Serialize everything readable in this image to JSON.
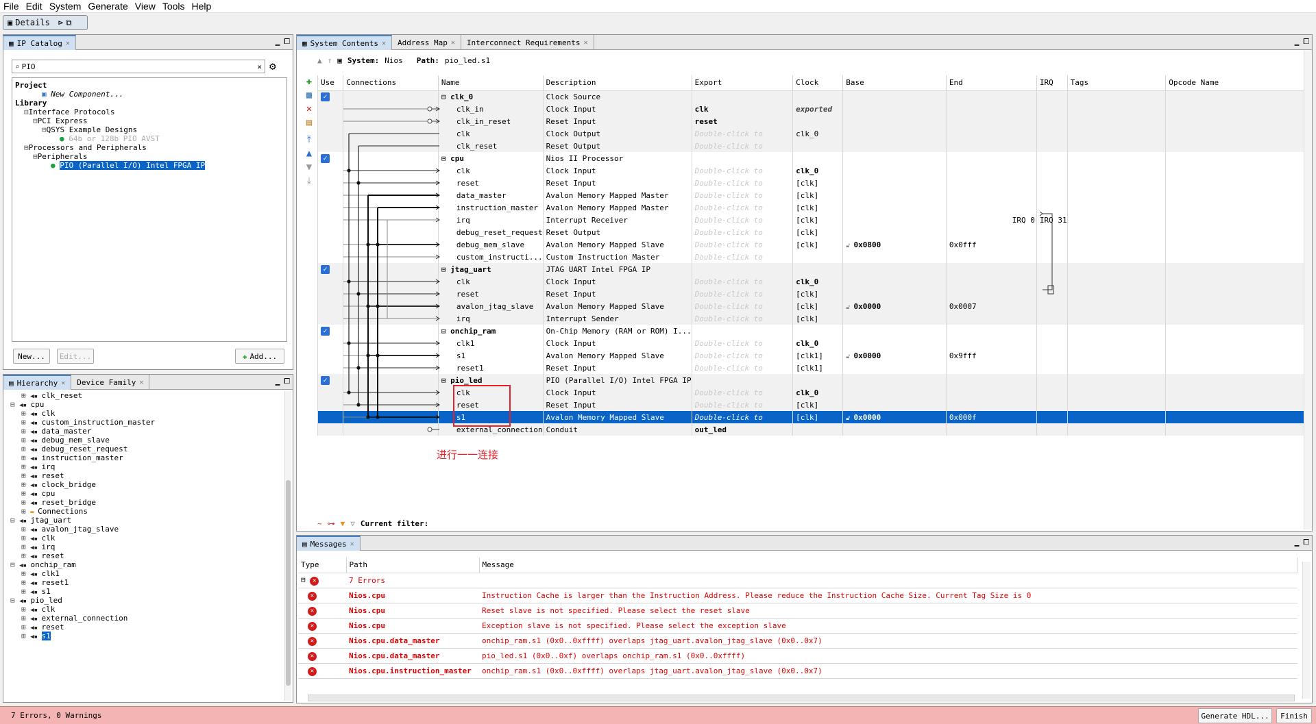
{
  "menu": [
    "File",
    "Edit",
    "System",
    "Generate",
    "View",
    "Tools",
    "Help"
  ],
  "details_tab": "Details",
  "ipcatalog": {
    "tab": "IP Catalog",
    "search": "PIO",
    "tree": [
      {
        "text": "Project",
        "bold": true,
        "indent": 0
      },
      {
        "text": "New Component...",
        "italic": true,
        "indent": 3
      },
      {
        "text": "Library",
        "bold": true,
        "indent": 0
      },
      {
        "text": "Interface Protocols",
        "indent": 1
      },
      {
        "text": "PCI Express",
        "indent": 2
      },
      {
        "text": "QSYS Example Designs",
        "indent": 3
      },
      {
        "text": "64b or 128b PIO AVST",
        "indent": 5,
        "grey": true
      },
      {
        "text": "Processors and Peripherals",
        "indent": 1
      },
      {
        "text": "Peripherals",
        "indent": 2
      },
      {
        "text": "PIO (Parallel I/O) Intel FPGA IP",
        "indent": 4,
        "selected": true
      }
    ],
    "new_btn": "New...",
    "edit_btn": "Edit...",
    "add_btn": "Add..."
  },
  "hierarchy": {
    "tab1": "Hierarchy",
    "tab2": "Device Family",
    "rows": [
      {
        "t": "clk_reset",
        "i": 2
      },
      {
        "t": "cpu",
        "i": 0
      },
      {
        "t": "clk",
        "i": 2
      },
      {
        "t": "custom_instruction_master",
        "i": 2
      },
      {
        "t": "data_master",
        "i": 2
      },
      {
        "t": "debug_mem_slave",
        "i": 2
      },
      {
        "t": "debug_reset_request",
        "i": 2
      },
      {
        "t": "instruction_master",
        "i": 2
      },
      {
        "t": "irq",
        "i": 2
      },
      {
        "t": "reset",
        "i": 2
      },
      {
        "t": "clock_bridge",
        "i": 2
      },
      {
        "t": "cpu",
        "i": 2
      },
      {
        "t": "reset_bridge",
        "i": 2
      },
      {
        "t": "Connections",
        "i": 2
      },
      {
        "t": "jtag_uart",
        "i": 0
      },
      {
        "t": "avalon_jtag_slave",
        "i": 2
      },
      {
        "t": "clk",
        "i": 2
      },
      {
        "t": "irq",
        "i": 2
      },
      {
        "t": "reset",
        "i": 2
      },
      {
        "t": "onchip_ram",
        "i": 0
      },
      {
        "t": "clk1",
        "i": 2
      },
      {
        "t": "reset1",
        "i": 2
      },
      {
        "t": "s1",
        "i": 2
      },
      {
        "t": "pio_led",
        "i": 0
      },
      {
        "t": "clk",
        "i": 2
      },
      {
        "t": "external_connection",
        "i": 2
      },
      {
        "t": "reset",
        "i": 2
      },
      {
        "t": "s1",
        "i": 2,
        "sel": true
      }
    ]
  },
  "system": {
    "tabs": [
      "System Contents",
      "Address Map",
      "Interconnect Requirements"
    ],
    "system_label": "System:",
    "system_name": "Nios",
    "path_label": "Path:",
    "path_value": "pio_led.s1",
    "headers": [
      "Use",
      "Connections",
      "Name",
      "Description",
      "Export",
      "Clock",
      "Base",
      "End",
      "IRQ",
      "Tags",
      "Opcode Name"
    ],
    "rows": [
      {
        "g": 0,
        "use": true,
        "name": "clk_0",
        "bold": true,
        "desc": "Clock Source",
        "export": "",
        "clock": "",
        "base": "",
        "end": ""
      },
      {
        "g": 0,
        "name": "clk_in",
        "desc": "Clock Input",
        "export": "clk",
        "exb": true,
        "clock": "exported",
        "cit": true
      },
      {
        "g": 0,
        "name": "clk_in_reset",
        "desc": "Reset Input",
        "export": "reset",
        "exb": true
      },
      {
        "g": 0,
        "name": "clk",
        "desc": "Clock Output",
        "export": "Double-click to",
        "exi": true,
        "clock": "clk_0"
      },
      {
        "g": 0,
        "name": "clk_reset",
        "desc": "Reset Output",
        "export": "Double-click to",
        "exi": true
      },
      {
        "g": 1,
        "use": true,
        "name": "cpu",
        "bold": true,
        "desc": "Nios II Processor"
      },
      {
        "g": 1,
        "name": "clk",
        "desc": "Clock Input",
        "export": "Double-click to",
        "exi": true,
        "clock": "clk_0",
        "cb": true
      },
      {
        "g": 1,
        "name": "reset",
        "desc": "Reset Input",
        "export": "Double-click to",
        "exi": true,
        "clock": "[clk]"
      },
      {
        "g": 1,
        "name": "data_master",
        "desc": "Avalon Memory Mapped Master",
        "export": "Double-click to",
        "exi": true,
        "clock": "[clk]"
      },
      {
        "g": 1,
        "name": "instruction_master",
        "desc": "Avalon Memory Mapped Master",
        "export": "Double-click to",
        "exi": true,
        "clock": "[clk]"
      },
      {
        "g": 1,
        "name": "irq",
        "desc": "Interrupt Receiver",
        "export": "Double-click to",
        "exi": true,
        "clock": "[clk]",
        "end": "IRQ 0",
        "irq": "IRQ 31"
      },
      {
        "g": 1,
        "name": "debug_reset_request",
        "desc": "Reset Output",
        "export": "Double-click to",
        "exi": true,
        "clock": "[clk]"
      },
      {
        "g": 1,
        "name": "debug_mem_slave",
        "desc": "Avalon Memory Mapped Slave",
        "export": "Double-click to",
        "exi": true,
        "clock": "[clk]",
        "base": "0x0800",
        "end": "0x0fff"
      },
      {
        "g": 1,
        "name": "custom_instructi...",
        "desc": "Custom Instruction Master",
        "export": "Double-click to",
        "exi": true
      },
      {
        "g": 0,
        "use": true,
        "name": "jtag_uart",
        "bold": true,
        "desc": "JTAG UART Intel FPGA IP"
      },
      {
        "g": 0,
        "name": "clk",
        "desc": "Clock Input",
        "export": "Double-click to",
        "exi": true,
        "clock": "clk_0",
        "cb": true
      },
      {
        "g": 0,
        "name": "reset",
        "desc": "Reset Input",
        "export": "Double-click to",
        "exi": true,
        "clock": "[clk]"
      },
      {
        "g": 0,
        "name": "avalon_jtag_slave",
        "desc": "Avalon Memory Mapped Slave",
        "export": "Double-click to",
        "exi": true,
        "clock": "[clk]",
        "base": "0x0000",
        "end": "0x0007"
      },
      {
        "g": 0,
        "name": "irq",
        "desc": "Interrupt Sender",
        "export": "Double-click to",
        "exi": true,
        "clock": "[clk]"
      },
      {
        "g": 1,
        "use": true,
        "name": "onchip_ram",
        "bold": true,
        "desc": "On-Chip Memory (RAM or ROM) I..."
      },
      {
        "g": 1,
        "name": "clk1",
        "desc": "Clock Input",
        "export": "Double-click to",
        "exi": true,
        "clock": "clk_0",
        "cb": true
      },
      {
        "g": 1,
        "name": "s1",
        "desc": "Avalon Memory Mapped Slave",
        "export": "Double-click to",
        "exi": true,
        "clock": "[clk1]",
        "base": "0x0000",
        "end": "0x9fff"
      },
      {
        "g": 1,
        "name": "reset1",
        "desc": "Reset Input",
        "export": "Double-click to",
        "exi": true,
        "clock": "[clk1]"
      },
      {
        "g": 0,
        "use": true,
        "name": "pio_led",
        "bold": true,
        "desc": "PIO (Parallel I/O) Intel FPGA IP"
      },
      {
        "g": 0,
        "name": "clk",
        "desc": "Clock Input",
        "export": "Double-click to",
        "exi": true,
        "clock": "clk_0",
        "cb": true
      },
      {
        "g": 0,
        "name": "reset",
        "desc": "Reset Input",
        "export": "Double-click to",
        "exi": true,
        "clock": "[clk]"
      },
      {
        "g": 0,
        "sel": true,
        "name": "s1",
        "desc": "Avalon Memory Mapped Slave",
        "export": "Double-click to",
        "exi": true,
        "clock": "[clk]",
        "base": "0x0000",
        "end": "0x000f"
      },
      {
        "g": 0,
        "name": "external_connection",
        "desc": "Conduit",
        "export": "out_led",
        "exb": true
      }
    ],
    "annotation": "进行一一连接",
    "filter_label": "Current filter:"
  },
  "messages": {
    "tab": "Messages",
    "headers": [
      "Type",
      "Path",
      "Message"
    ],
    "summary": "7 Errors",
    "rows": [
      {
        "path": "Nios.cpu",
        "msg": "Instruction Cache is larger than the Instruction Address. Please reduce the Instruction Cache Size. Current Tag Size is 0"
      },
      {
        "path": "Nios.cpu",
        "msg": "Reset slave is not specified. Please select the reset slave"
      },
      {
        "path": "Nios.cpu",
        "msg": "Exception slave is not specified. Please select the exception slave"
      },
      {
        "path": "Nios.cpu.data_master",
        "msg": "onchip_ram.s1 (0x0..0xffff) overlaps jtag_uart.avalon_jtag_slave (0x0..0x7)"
      },
      {
        "path": "Nios.cpu.data_master",
        "msg": "pio_led.s1 (0x0..0xf) overlaps onchip_ram.s1 (0x0..0xffff)"
      },
      {
        "path": "Nios.cpu.instruction_master",
        "msg": "onchip_ram.s1 (0x0..0xffff) overlaps jtag_uart.avalon_jtag_slave (0x0..0x7)"
      }
    ]
  },
  "status": {
    "text": "7 Errors, 0 Warnings",
    "generate_btn": "Generate HDL...",
    "finish_btn": "Finish"
  }
}
